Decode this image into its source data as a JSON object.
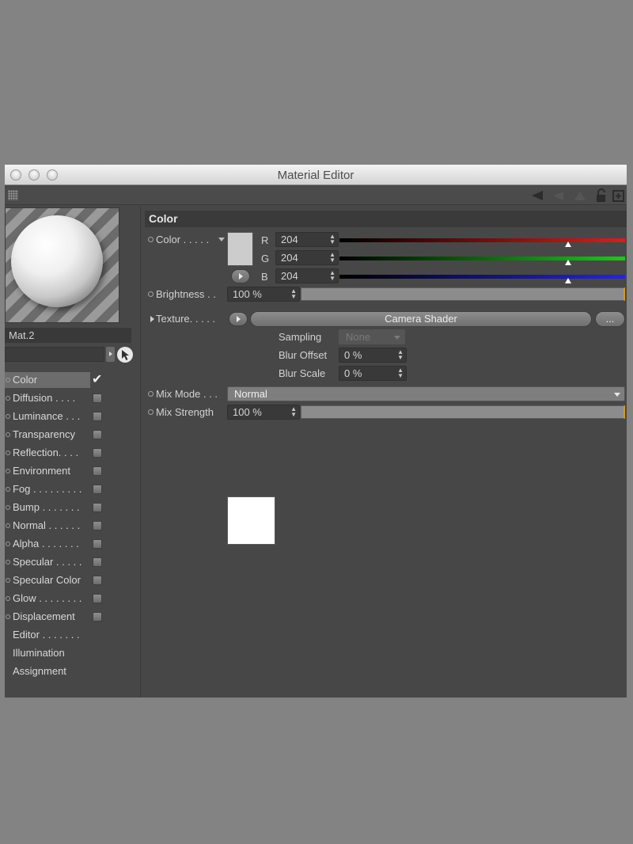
{
  "window": {
    "title": "Material Editor"
  },
  "material": {
    "name": "Mat.2"
  },
  "channels": [
    {
      "label": "Color",
      "has_checkbox": true,
      "checked": true,
      "selected": true
    },
    {
      "label": "Diffusion . . . .",
      "has_checkbox": true,
      "checked": false
    },
    {
      "label": "Luminance . . .",
      "has_checkbox": true,
      "checked": false
    },
    {
      "label": "Transparency",
      "has_checkbox": true,
      "checked": false
    },
    {
      "label": "Reflection. . . .",
      "has_checkbox": true,
      "checked": false
    },
    {
      "label": "Environment",
      "has_checkbox": true,
      "checked": false
    },
    {
      "label": "Fog . . . . . . . . .",
      "has_checkbox": true,
      "checked": false
    },
    {
      "label": "Bump . . . . . . .",
      "has_checkbox": true,
      "checked": false
    },
    {
      "label": "Normal . . . . . .",
      "has_checkbox": true,
      "checked": false
    },
    {
      "label": "Alpha . . . . . . .",
      "has_checkbox": true,
      "checked": false
    },
    {
      "label": "Specular . . . . .",
      "has_checkbox": true,
      "checked": false
    },
    {
      "label": "Specular Color",
      "has_checkbox": true,
      "checked": false
    },
    {
      "label": "Glow . . . . . . . .",
      "has_checkbox": true,
      "checked": false
    },
    {
      "label": "Displacement",
      "has_checkbox": true,
      "checked": false
    },
    {
      "label": "Editor . . . . . . .",
      "has_checkbox": false
    },
    {
      "label": "Illumination",
      "has_checkbox": false
    },
    {
      "label": "Assignment",
      "has_checkbox": false
    }
  ],
  "color_section": {
    "header": "Color",
    "color_label": "Color . . . . .",
    "swatch_color": "#cccccc",
    "r_label": "R",
    "r_value": "204",
    "g_label": "G",
    "g_value": "204",
    "b_label": "B",
    "b_value": "204",
    "slider_fraction": 0.8,
    "brightness_label": "Brightness . .",
    "brightness_value": "100 %",
    "texture_label": "Texture. . . . .",
    "texture_shader": "Camera Shader",
    "texture_more": "...",
    "sampling_label": "Sampling",
    "sampling_value": "None",
    "blur_offset_label": "Blur Offset",
    "blur_offset_value": "0 %",
    "blur_scale_label": "Blur Scale",
    "blur_scale_value": "0 %",
    "mix_mode_label": "Mix Mode . . .",
    "mix_mode_value": "Normal",
    "mix_strength_label": "Mix Strength",
    "mix_strength_value": "100 %"
  },
  "colors": {
    "red": "#d42020",
    "green": "#21c521",
    "blue": "#2525d8",
    "accent": "#d39b2a"
  }
}
